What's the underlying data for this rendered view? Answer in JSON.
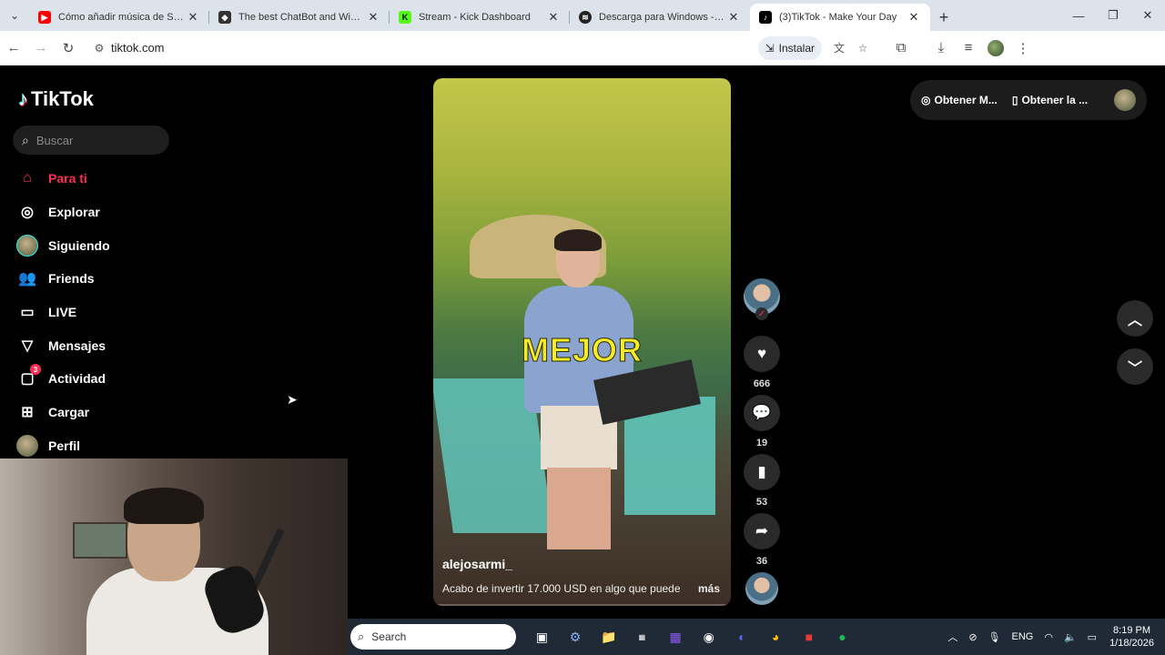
{
  "browser": {
    "tabs": [
      {
        "title": "Cómo añadir música de Spotify",
        "icon": "youtube-icon",
        "color": "#ff0000",
        "active": false
      },
      {
        "title": "The best ChatBot and Widgets",
        "icon": "chatbot-icon",
        "color": "#333333",
        "active": false
      },
      {
        "title": "Stream - Kick Dashboard",
        "icon": "kick-icon",
        "color": "#53fc18",
        "active": false
      },
      {
        "title": "Descarga para Windows - Spoti",
        "icon": "spotify-icon",
        "color": "#222222",
        "active": false
      },
      {
        "title": "(3)TikTok - Make Your Day",
        "icon": "tiktok-icon",
        "color": "#000000",
        "active": true
      }
    ],
    "url": "tiktok.com",
    "install_label": "Instalar"
  },
  "sidebar": {
    "logo_text": "TikTok",
    "search_placeholder": "Buscar",
    "items": [
      {
        "label": "Para ti",
        "icon": "home-icon",
        "active": true
      },
      {
        "label": "Explorar",
        "icon": "compass-icon"
      },
      {
        "label": "Siguiendo",
        "icon": "following-avatar-icon"
      },
      {
        "label": "Friends",
        "icon": "friends-icon"
      },
      {
        "label": "LIVE",
        "icon": "live-icon"
      },
      {
        "label": "Mensajes",
        "icon": "send-icon"
      },
      {
        "label": "Actividad",
        "icon": "activity-icon",
        "badge": "3"
      },
      {
        "label": "Cargar",
        "icon": "upload-icon"
      },
      {
        "label": "Perfil",
        "icon": "profile-avatar-icon"
      }
    ]
  },
  "video": {
    "caption": "MEJOR",
    "username": "alejosarmi_",
    "description": "Acabo de invertir 17.000 USD en algo que puede",
    "more_label": "más"
  },
  "actions": {
    "likes": "666",
    "comments": "19",
    "saves": "53",
    "shares": "36"
  },
  "topbar": {
    "get_coins": "Obtener M...",
    "get_app": "Obtener la ..."
  },
  "taskbar": {
    "search": "Search",
    "lang": "ENG",
    "time": "8:19 PM",
    "date": "1/18/2026"
  }
}
